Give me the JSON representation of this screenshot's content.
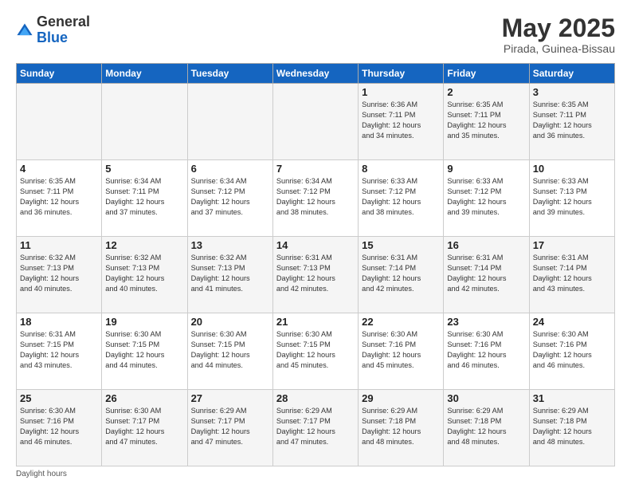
{
  "logo": {
    "general": "General",
    "blue": "Blue"
  },
  "title": "May 2025",
  "location": "Pirada, Guinea-Bissau",
  "days_of_week": [
    "Sunday",
    "Monday",
    "Tuesday",
    "Wednesday",
    "Thursday",
    "Friday",
    "Saturday"
  ],
  "footer": "Daylight hours",
  "weeks": [
    [
      {
        "day": "",
        "info": ""
      },
      {
        "day": "",
        "info": ""
      },
      {
        "day": "",
        "info": ""
      },
      {
        "day": "",
        "info": ""
      },
      {
        "day": "1",
        "info": "Sunrise: 6:36 AM\nSunset: 7:11 PM\nDaylight: 12 hours\nand 34 minutes."
      },
      {
        "day": "2",
        "info": "Sunrise: 6:35 AM\nSunset: 7:11 PM\nDaylight: 12 hours\nand 35 minutes."
      },
      {
        "day": "3",
        "info": "Sunrise: 6:35 AM\nSunset: 7:11 PM\nDaylight: 12 hours\nand 36 minutes."
      }
    ],
    [
      {
        "day": "4",
        "info": "Sunrise: 6:35 AM\nSunset: 7:11 PM\nDaylight: 12 hours\nand 36 minutes."
      },
      {
        "day": "5",
        "info": "Sunrise: 6:34 AM\nSunset: 7:11 PM\nDaylight: 12 hours\nand 37 minutes."
      },
      {
        "day": "6",
        "info": "Sunrise: 6:34 AM\nSunset: 7:12 PM\nDaylight: 12 hours\nand 37 minutes."
      },
      {
        "day": "7",
        "info": "Sunrise: 6:34 AM\nSunset: 7:12 PM\nDaylight: 12 hours\nand 38 minutes."
      },
      {
        "day": "8",
        "info": "Sunrise: 6:33 AM\nSunset: 7:12 PM\nDaylight: 12 hours\nand 38 minutes."
      },
      {
        "day": "9",
        "info": "Sunrise: 6:33 AM\nSunset: 7:12 PM\nDaylight: 12 hours\nand 39 minutes."
      },
      {
        "day": "10",
        "info": "Sunrise: 6:33 AM\nSunset: 7:13 PM\nDaylight: 12 hours\nand 39 minutes."
      }
    ],
    [
      {
        "day": "11",
        "info": "Sunrise: 6:32 AM\nSunset: 7:13 PM\nDaylight: 12 hours\nand 40 minutes."
      },
      {
        "day": "12",
        "info": "Sunrise: 6:32 AM\nSunset: 7:13 PM\nDaylight: 12 hours\nand 40 minutes."
      },
      {
        "day": "13",
        "info": "Sunrise: 6:32 AM\nSunset: 7:13 PM\nDaylight: 12 hours\nand 41 minutes."
      },
      {
        "day": "14",
        "info": "Sunrise: 6:31 AM\nSunset: 7:13 PM\nDaylight: 12 hours\nand 42 minutes."
      },
      {
        "day": "15",
        "info": "Sunrise: 6:31 AM\nSunset: 7:14 PM\nDaylight: 12 hours\nand 42 minutes."
      },
      {
        "day": "16",
        "info": "Sunrise: 6:31 AM\nSunset: 7:14 PM\nDaylight: 12 hours\nand 42 minutes."
      },
      {
        "day": "17",
        "info": "Sunrise: 6:31 AM\nSunset: 7:14 PM\nDaylight: 12 hours\nand 43 minutes."
      }
    ],
    [
      {
        "day": "18",
        "info": "Sunrise: 6:31 AM\nSunset: 7:15 PM\nDaylight: 12 hours\nand 43 minutes."
      },
      {
        "day": "19",
        "info": "Sunrise: 6:30 AM\nSunset: 7:15 PM\nDaylight: 12 hours\nand 44 minutes."
      },
      {
        "day": "20",
        "info": "Sunrise: 6:30 AM\nSunset: 7:15 PM\nDaylight: 12 hours\nand 44 minutes."
      },
      {
        "day": "21",
        "info": "Sunrise: 6:30 AM\nSunset: 7:15 PM\nDaylight: 12 hours\nand 45 minutes."
      },
      {
        "day": "22",
        "info": "Sunrise: 6:30 AM\nSunset: 7:16 PM\nDaylight: 12 hours\nand 45 minutes."
      },
      {
        "day": "23",
        "info": "Sunrise: 6:30 AM\nSunset: 7:16 PM\nDaylight: 12 hours\nand 46 minutes."
      },
      {
        "day": "24",
        "info": "Sunrise: 6:30 AM\nSunset: 7:16 PM\nDaylight: 12 hours\nand 46 minutes."
      }
    ],
    [
      {
        "day": "25",
        "info": "Sunrise: 6:30 AM\nSunset: 7:16 PM\nDaylight: 12 hours\nand 46 minutes."
      },
      {
        "day": "26",
        "info": "Sunrise: 6:30 AM\nSunset: 7:17 PM\nDaylight: 12 hours\nand 47 minutes."
      },
      {
        "day": "27",
        "info": "Sunrise: 6:29 AM\nSunset: 7:17 PM\nDaylight: 12 hours\nand 47 minutes."
      },
      {
        "day": "28",
        "info": "Sunrise: 6:29 AM\nSunset: 7:17 PM\nDaylight: 12 hours\nand 47 minutes."
      },
      {
        "day": "29",
        "info": "Sunrise: 6:29 AM\nSunset: 7:18 PM\nDaylight: 12 hours\nand 48 minutes."
      },
      {
        "day": "30",
        "info": "Sunrise: 6:29 AM\nSunset: 7:18 PM\nDaylight: 12 hours\nand 48 minutes."
      },
      {
        "day": "31",
        "info": "Sunrise: 6:29 AM\nSunset: 7:18 PM\nDaylight: 12 hours\nand 48 minutes."
      }
    ]
  ]
}
